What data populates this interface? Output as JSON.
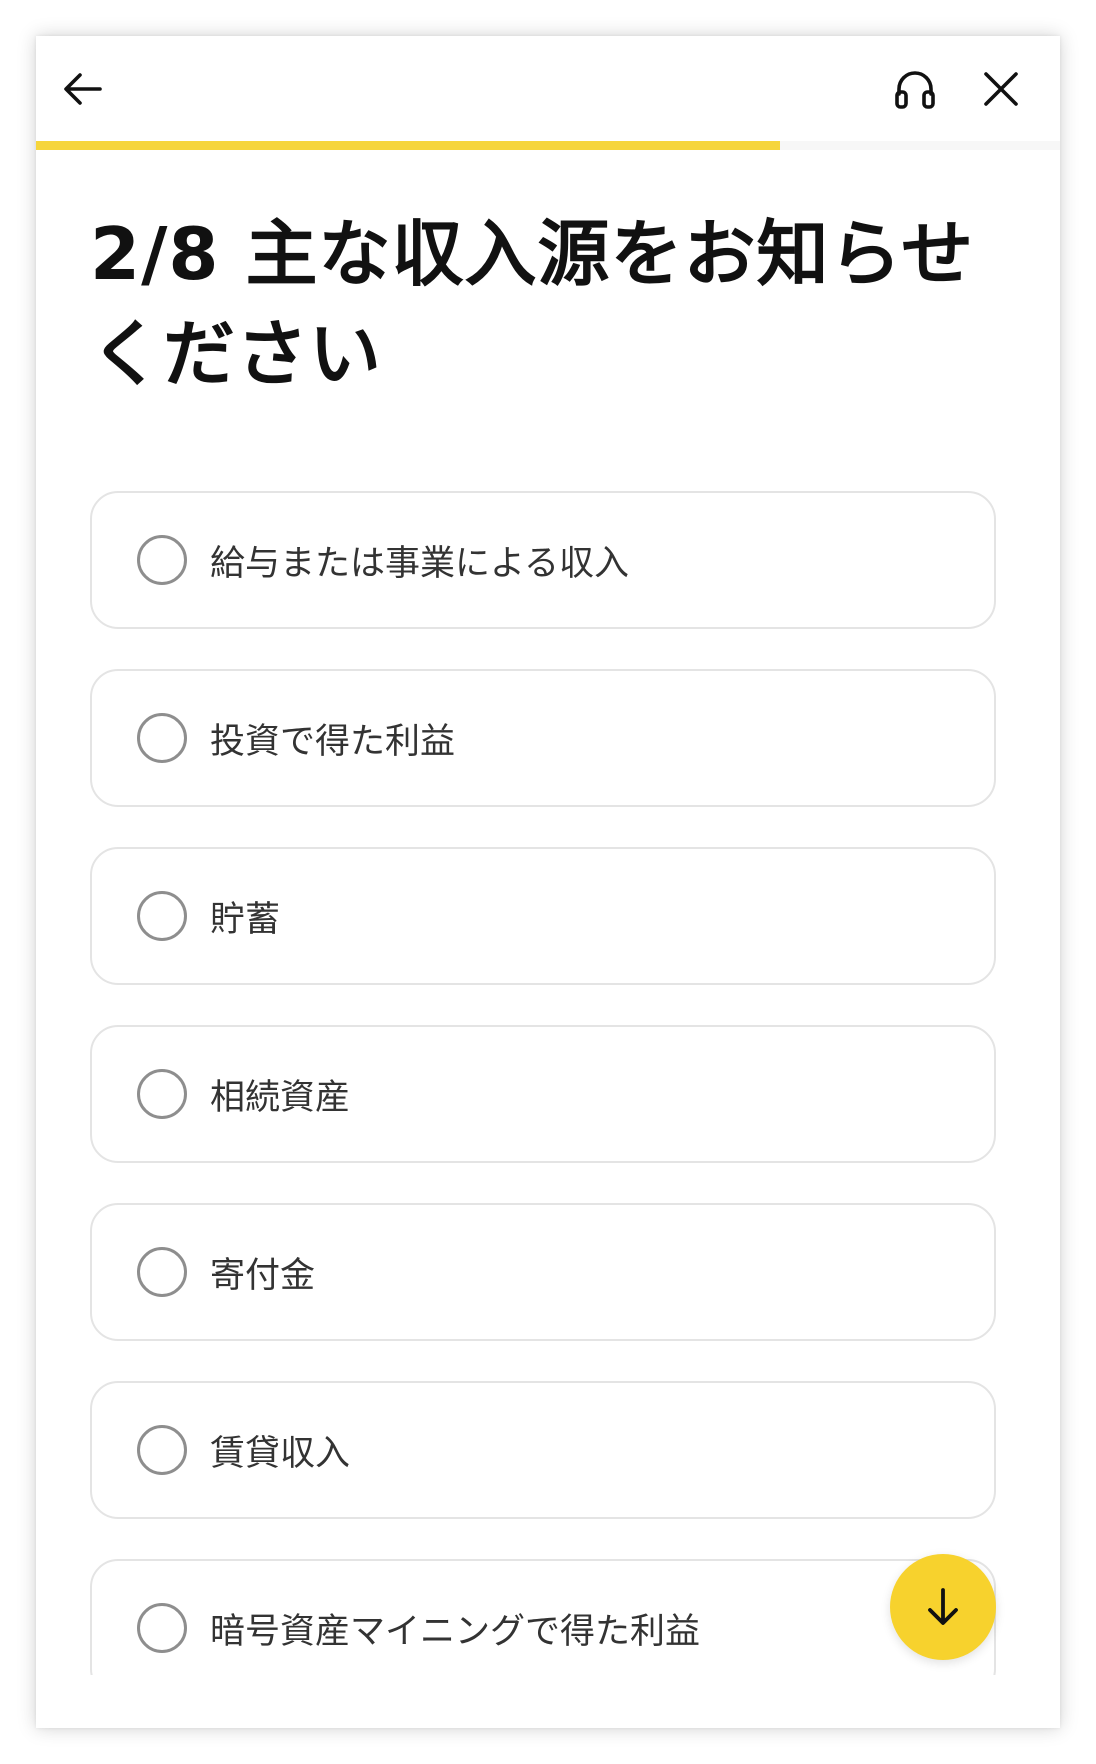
{
  "header": {
    "back_icon": "arrow-left-icon",
    "support_icon": "headset-icon",
    "close_icon": "close-icon"
  },
  "progress": {
    "step": 2,
    "total": 8,
    "fraction": 0.727,
    "color": "#f6d53b"
  },
  "question": {
    "title": "2/8 主な収入源をお知らせください"
  },
  "options": [
    {
      "label": "給与または事業による収入",
      "selected": false
    },
    {
      "label": "投資で得た利益",
      "selected": false
    },
    {
      "label": "貯蓄",
      "selected": false
    },
    {
      "label": "相続資産",
      "selected": false
    },
    {
      "label": "寄付金",
      "selected": false
    },
    {
      "label": "賃貸収入",
      "selected": false
    },
    {
      "label": "暗号資産マイニングで得た利益",
      "selected": false
    }
  ],
  "scroll_button": {
    "icon": "arrow-down-icon",
    "color": "#f7d22d"
  }
}
